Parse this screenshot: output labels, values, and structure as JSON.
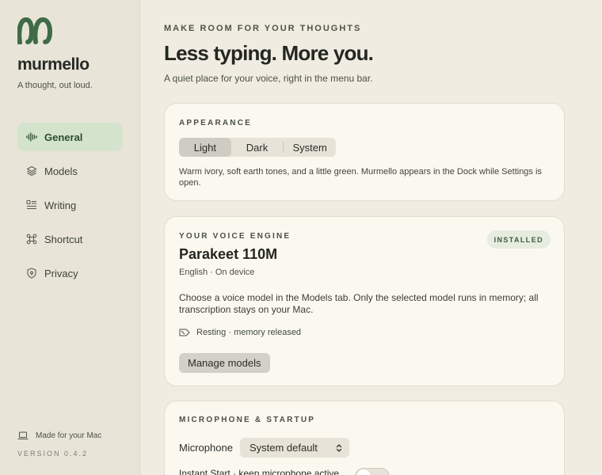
{
  "brand": {
    "name": "murmello",
    "tagline": "A thought, out loud.",
    "logo_icon": "murmello-logo-icon",
    "accent_color": "#3f6b47"
  },
  "sidebar": {
    "items": [
      {
        "label": "General",
        "icon": "waveform-icon",
        "active": true
      },
      {
        "label": "Models",
        "icon": "layers-icon",
        "active": false
      },
      {
        "label": "Writing",
        "icon": "text-lines-icon",
        "active": false
      },
      {
        "label": "Shortcut",
        "icon": "command-icon",
        "active": false
      },
      {
        "label": "Privacy",
        "icon": "shield-icon",
        "active": false
      }
    ],
    "footer": {
      "made_for": "Made for your Mac",
      "made_for_icon": "laptop-icon",
      "version": "VERSION 0.4.2"
    }
  },
  "main": {
    "eyebrow": "MAKE ROOM FOR YOUR THOUGHTS",
    "headline": "Less typing. More you.",
    "subhead": "A quiet place for your voice, right in the menu bar."
  },
  "appearance": {
    "label": "APPEARANCE",
    "options": [
      "Light",
      "Dark",
      "System"
    ],
    "selected": "Light",
    "description": "Warm ivory, soft earth tones, and a little green. Murmello appears in the Dock while Settings is open."
  },
  "engine": {
    "label": "YOUR VOICE ENGINE",
    "badge": "INSTALLED",
    "title": "Parakeet 110M",
    "meta": "English · On device",
    "description": "Choose a voice model in the Models tab. Only the selected model runs in memory; all transcription stays on your Mac.",
    "status": "Resting · memory released",
    "status_icon": "sleep-icon",
    "manage_label": "Manage models"
  },
  "mic": {
    "label": "MICROPHONE & STARTUP",
    "microphone_label": "Microphone",
    "microphone_value": "System default",
    "instant_start_label": "Instant Start · keep microphone active",
    "instant_start_on": false
  }
}
